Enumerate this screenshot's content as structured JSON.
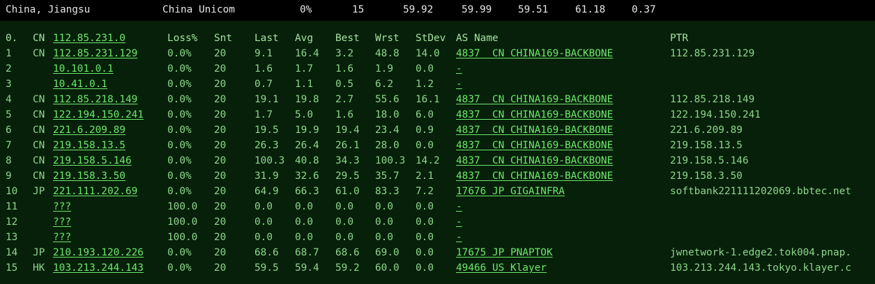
{
  "summary": {
    "region": "China, Jiangsu",
    "isp": "China Unicom",
    "loss": "0%",
    "snt": "15",
    "last": "59.92",
    "avg": "59.99",
    "best": "59.51",
    "wrst": "61.18",
    "stdev": "0.37"
  },
  "header": {
    "hop": "0.",
    "cc": "CN",
    "ip": "112.85.231.0",
    "loss": "Loss%",
    "snt": "Snt",
    "last": "Last",
    "avg": "Avg",
    "best": "Best",
    "wrst": "Wrst",
    "stdev": "StDev",
    "asname": "AS Name",
    "ptr": "PTR"
  },
  "hops": [
    {
      "hop": "1",
      "cc": "CN",
      "ip": "112.85.231.129",
      "loss": "0.0%",
      "snt": "20",
      "last": "9.1",
      "avg": "16.4",
      "best": "3.2",
      "wrst": "48.8",
      "stdev": "14.0",
      "as": "4837  CN CHINA169-BACKBONE",
      "ptr": "112.85.231.129"
    },
    {
      "hop": "2",
      "cc": "",
      "ip": "10.101.0.1",
      "loss": "0.0%",
      "snt": "20",
      "last": "1.6",
      "avg": "1.7",
      "best": "1.6",
      "wrst": "1.9",
      "stdev": "0.0",
      "as": "-",
      "ptr": ""
    },
    {
      "hop": "3",
      "cc": "",
      "ip": "10.41.0.1",
      "loss": "0.0%",
      "snt": "20",
      "last": "0.7",
      "avg": "1.1",
      "best": "0.5",
      "wrst": "6.2",
      "stdev": "1.2",
      "as": "-",
      "ptr": ""
    },
    {
      "hop": "4",
      "cc": "CN",
      "ip": "112.85.218.149",
      "loss": "0.0%",
      "snt": "20",
      "last": "19.1",
      "avg": "19.8",
      "best": "2.7",
      "wrst": "55.6",
      "stdev": "16.1",
      "as": "4837  CN CHINA169-BACKBONE",
      "ptr": "112.85.218.149"
    },
    {
      "hop": "5",
      "cc": "CN",
      "ip": "122.194.150.241",
      "loss": "0.0%",
      "snt": "20",
      "last": "1.7",
      "avg": "5.0",
      "best": "1.6",
      "wrst": "18.0",
      "stdev": "6.0",
      "as": "4837  CN CHINA169-BACKBONE",
      "ptr": "122.194.150.241"
    },
    {
      "hop": "6",
      "cc": "CN",
      "ip": "221.6.209.89",
      "loss": "0.0%",
      "snt": "20",
      "last": "19.5",
      "avg": "19.9",
      "best": "19.4",
      "wrst": "23.4",
      "stdev": "0.9",
      "as": "4837  CN CHINA169-BACKBONE",
      "ptr": "221.6.209.89"
    },
    {
      "hop": "7",
      "cc": "CN",
      "ip": "219.158.13.5",
      "loss": "0.0%",
      "snt": "20",
      "last": "26.3",
      "avg": "26.4",
      "best": "26.1",
      "wrst": "28.0",
      "stdev": "0.0",
      "as": "4837  CN CHINA169-BACKBONE",
      "ptr": "219.158.13.5"
    },
    {
      "hop": "8",
      "cc": "CN",
      "ip": "219.158.5.146",
      "loss": "0.0%",
      "snt": "20",
      "last": "100.3",
      "avg": "40.8",
      "best": "34.3",
      "wrst": "100.3",
      "stdev": "14.2",
      "as": "4837  CN CHINA169-BACKBONE",
      "ptr": "219.158.5.146"
    },
    {
      "hop": "9",
      "cc": "CN",
      "ip": "219.158.3.50",
      "loss": "0.0%",
      "snt": "20",
      "last": "31.9",
      "avg": "32.6",
      "best": "29.5",
      "wrst": "35.7",
      "stdev": "2.1",
      "as": "4837  CN CHINA169-BACKBONE",
      "ptr": "219.158.3.50"
    },
    {
      "hop": "10",
      "cc": "JP",
      "ip": "221.111.202.69",
      "loss": "0.0%",
      "snt": "20",
      "last": "64.9",
      "avg": "66.3",
      "best": "61.0",
      "wrst": "83.3",
      "stdev": "7.2",
      "as": "17676 JP GIGAINFRA",
      "ptr": "softbank221111202069.bbtec.net"
    },
    {
      "hop": "11",
      "cc": "",
      "ip": "???",
      "loss": "100.0",
      "snt": "20",
      "last": "0.0",
      "avg": "0.0",
      "best": "0.0",
      "wrst": "0.0",
      "stdev": "0.0",
      "as": "-",
      "ptr": ""
    },
    {
      "hop": "12",
      "cc": "",
      "ip": "???",
      "loss": "100.0",
      "snt": "20",
      "last": "0.0",
      "avg": "0.0",
      "best": "0.0",
      "wrst": "0.0",
      "stdev": "0.0",
      "as": "-",
      "ptr": ""
    },
    {
      "hop": "13",
      "cc": "",
      "ip": "???",
      "loss": "100.0",
      "snt": "20",
      "last": "0.0",
      "avg": "0.0",
      "best": "0.0",
      "wrst": "0.0",
      "stdev": "0.0",
      "as": "-",
      "ptr": ""
    },
    {
      "hop": "14",
      "cc": "JP",
      "ip": "210.193.120.226",
      "loss": "0.0%",
      "snt": "20",
      "last": "68.6",
      "avg": "68.7",
      "best": "68.6",
      "wrst": "69.0",
      "stdev": "0.0",
      "as": "17675 JP PNAPTOK",
      "ptr": "jwnetwork-1.edge2.tok004.pnap."
    },
    {
      "hop": "15",
      "cc": "HK",
      "ip": "103.213.244.143",
      "loss": "0.0%",
      "snt": "20",
      "last": "59.5",
      "avg": "59.4",
      "best": "59.2",
      "wrst": "60.0",
      "stdev": "0.0",
      "as": "49466 US Klayer",
      "ptr": "103.213.244.143.tokyo.klayer.c"
    }
  ]
}
